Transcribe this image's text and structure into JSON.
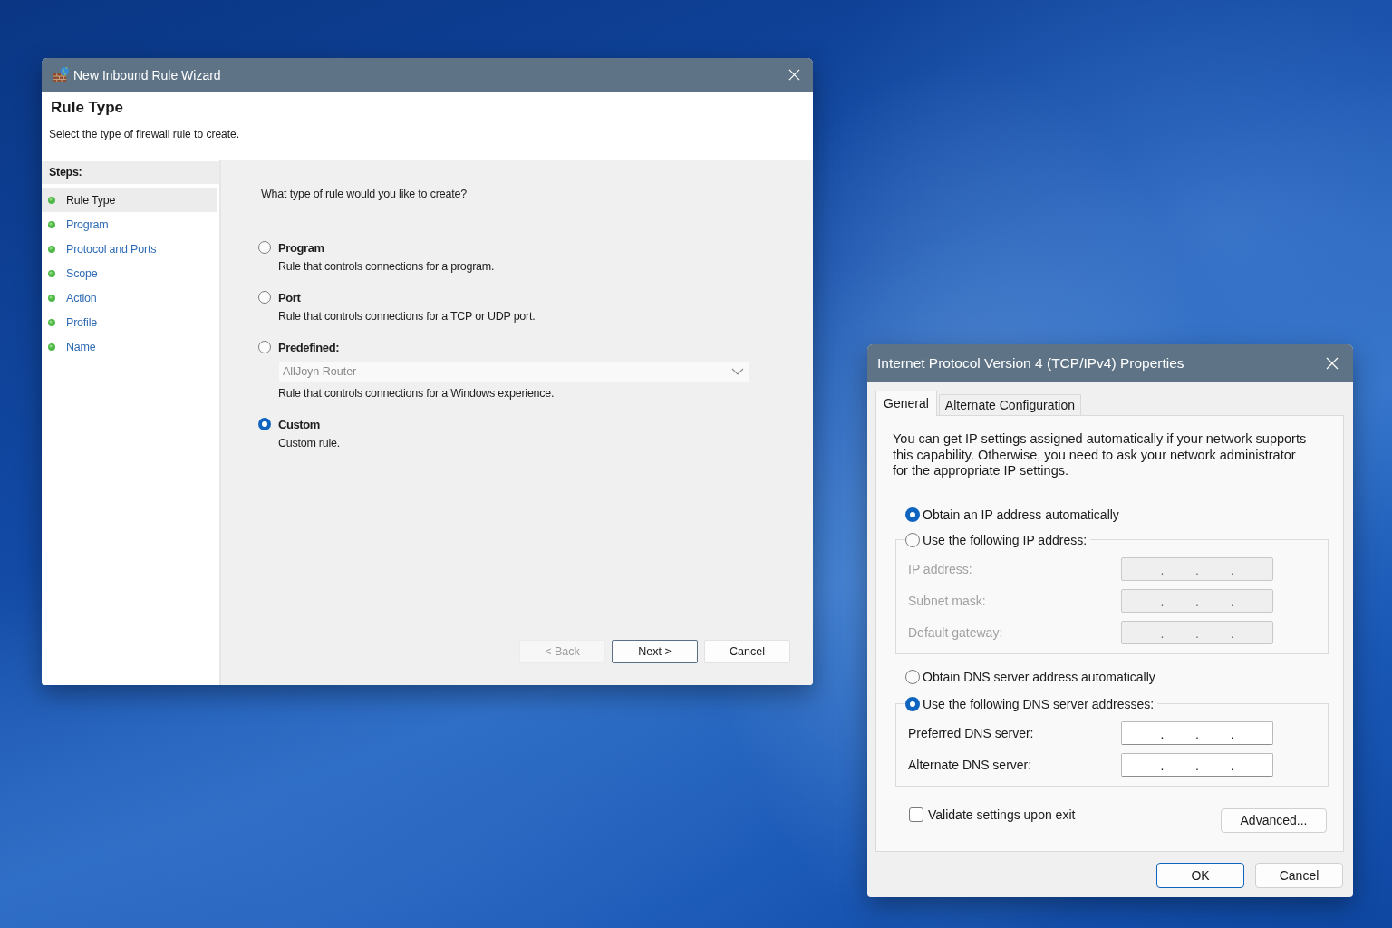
{
  "wizard": {
    "title": "New Inbound Rule Wizard",
    "heading": "Rule Type",
    "subheading": "Select the type of firewall rule to create.",
    "steps_header": "Steps:",
    "steps": [
      {
        "label": "Rule Type",
        "selected": true
      },
      {
        "label": "Program",
        "selected": false
      },
      {
        "label": "Protocol and Ports",
        "selected": false
      },
      {
        "label": "Scope",
        "selected": false
      },
      {
        "label": "Action",
        "selected": false
      },
      {
        "label": "Profile",
        "selected": false
      },
      {
        "label": "Name",
        "selected": false
      }
    ],
    "question": "What type of rule would you like to create?",
    "options": [
      {
        "label": "Program",
        "description": "Rule that controls connections for a program.",
        "selected": false
      },
      {
        "label": "Port",
        "description": "Rule that controls connections for a TCP or UDP port.",
        "selected": false
      },
      {
        "label": "Predefined:",
        "dropdown": {
          "value": "AllJoyn Router",
          "disabled": true
        },
        "description": "Rule that controls connections for a Windows experience.",
        "selected": false
      },
      {
        "label": "Custom",
        "description": "Custom rule.",
        "selected": true
      }
    ],
    "buttons": [
      {
        "label": "< Back",
        "disabled": true,
        "default": false
      },
      {
        "label": "Next >",
        "disabled": false,
        "default": true
      },
      {
        "label": "Cancel",
        "disabled": false,
        "default": false
      }
    ]
  },
  "ip_dialog": {
    "title": "Internet Protocol Version 4 (TCP/IPv4) Properties",
    "tabs": [
      {
        "label": "General",
        "selected": true
      },
      {
        "label": "Alternate Configuration",
        "selected": false
      }
    ],
    "intro": "You can get IP settings assigned automatically if your network supports this capability. Otherwise, you need to ask your network administrator for the appropriate IP settings.",
    "ip_auto": {
      "label": "Obtain an IP address automatically",
      "selected": true
    },
    "ip_manual": {
      "label": "Use the following IP address:",
      "selected": false
    },
    "ip_fields": [
      {
        "label": "IP address:",
        "disabled": true,
        "separators": [
          ".",
          ".",
          "."
        ]
      },
      {
        "label": "Subnet mask:",
        "disabled": true,
        "separators": [
          ".",
          ".",
          "."
        ]
      },
      {
        "label": "Default gateway:",
        "disabled": true,
        "separators": [
          ".",
          ".",
          "."
        ]
      }
    ],
    "dns_auto": {
      "label": "Obtain DNS server address automatically",
      "selected": false
    },
    "dns_manual": {
      "label": "Use the following DNS server addresses:",
      "selected": true
    },
    "dns_fields": [
      {
        "label": "Preferred DNS server:",
        "disabled": false,
        "separators": [
          ".",
          ".",
          "."
        ]
      },
      {
        "label": "Alternate DNS server:",
        "disabled": false,
        "separators": [
          ".",
          ".",
          "."
        ]
      }
    ],
    "validate": {
      "label": "Validate settings upon exit",
      "checked": false
    },
    "advanced_button": "Advanced...",
    "buttons": [
      {
        "label": "OK",
        "default": true
      },
      {
        "label": "Cancel",
        "default": false
      }
    ]
  }
}
